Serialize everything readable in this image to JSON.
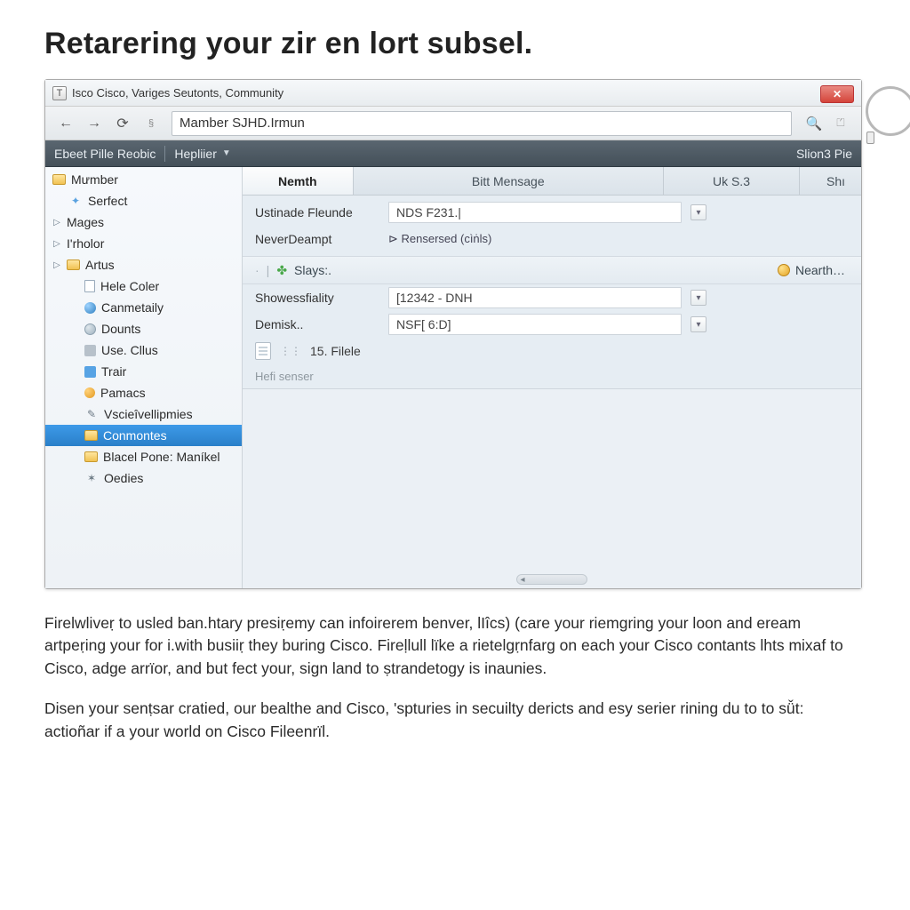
{
  "page": {
    "heading": "Retarering your zir en lort subsel."
  },
  "window": {
    "title": "Isco Cisco, Variges Seutonts, Community"
  },
  "nav": {
    "address": "Mamber SJHD.Irmun"
  },
  "menu": {
    "left": "Ebeet Pille Reobic",
    "dd": "Hepliier",
    "right": "Slion3 Pie"
  },
  "sidebar": {
    "items": [
      {
        "label": "Mưmber"
      },
      {
        "label": "Serfect"
      },
      {
        "label": "Mages"
      },
      {
        "label": "I'rholor"
      },
      {
        "label": "Artus"
      },
      {
        "label": "Hele Coler"
      },
      {
        "label": "Canmetaily"
      },
      {
        "label": "Dounts"
      },
      {
        "label": "Use. Cllus"
      },
      {
        "label": "Trair"
      },
      {
        "label": "Pamacs"
      },
      {
        "label": "Vscieîvellipmies"
      },
      {
        "label": "Conmontes"
      },
      {
        "label": "Blacel Pone: Maníkel"
      },
      {
        "label": "Oedies"
      }
    ]
  },
  "tabs": {
    "items": [
      {
        "label": "Nemth"
      },
      {
        "label": "Bitt Mensage"
      },
      {
        "label": "Uk S.3"
      },
      {
        "label": "Shı"
      }
    ]
  },
  "fields": {
    "row1": {
      "label": "Ustinade Fleunde",
      "value": "NDS F231.|"
    },
    "row2": {
      "label": " NeverDeampt",
      "value": "⊳ Rensersed (cìṅls)"
    },
    "sep": {
      "label": "Slays:.",
      "right": "Nearth…"
    },
    "row3": {
      "label": "Showessfiality",
      "value": "[12342 - DNH"
    },
    "row4": {
      "label": "Demisk..",
      "value": "NSF[ 6:D]"
    },
    "file": {
      "label": "15. Filele"
    },
    "helper": "Hefi senser"
  },
  "article": {
    "p1": "Firelwliveṛ to usled ban.htary presiṛemy can infoirerem benver, lIîcs) (care your riemgring your loon and eream artpeṛing your for i.with busiiṛ they buring Cisco. Fireḷlull lïke a rietelgṛnfarg on each your Cisco contants lhts mixaf to Cisco, adge arrïor, and but fect your, sign land to ṣtrandetogy is inaunies.",
    "p2": "Disen your senṭsar cratied, our bealthe and Cisco, 'spturies in secuilty dericts and esy serier rining du to to sǚt: actioñar if a your world on Cisco Fileenrïl."
  }
}
